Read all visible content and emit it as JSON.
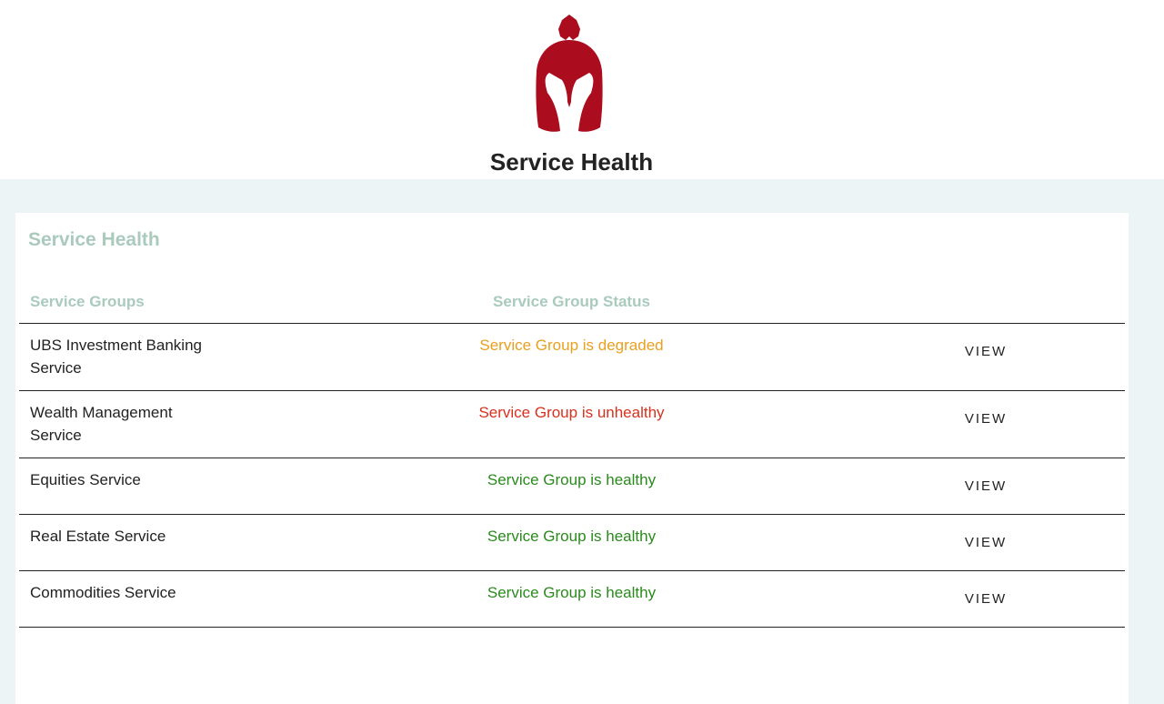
{
  "header": {
    "logo_icon": "spartan-helmet-icon",
    "logo_color": "#ab0d1f",
    "title": "Service Health"
  },
  "card": {
    "title": "Service Health",
    "columns": {
      "groups": "Service Groups",
      "status": "Service Group Status"
    },
    "rows": [
      {
        "name": "UBS Investment Banking Service",
        "status": "Service Group is degraded",
        "state": "degraded",
        "action": "VIEW"
      },
      {
        "name": "Wealth Management Service",
        "status": "Service Group is unhealthy",
        "state": "unhealthy",
        "action": "VIEW"
      },
      {
        "name": "Equities Service",
        "status": "Service Group is healthy",
        "state": "healthy",
        "action": "VIEW"
      },
      {
        "name": "Real Estate Service",
        "status": "Service Group is healthy",
        "state": "healthy",
        "action": "VIEW"
      },
      {
        "name": "Commodities Service",
        "status": "Service Group is healthy",
        "state": "healthy",
        "action": "VIEW"
      }
    ]
  },
  "colors": {
    "degraded": "#e8a020",
    "unhealthy": "#d8311d",
    "healthy": "#2a8a1c",
    "muted_heading": "#a9cabd",
    "page_background": "#ecf4f6"
  }
}
